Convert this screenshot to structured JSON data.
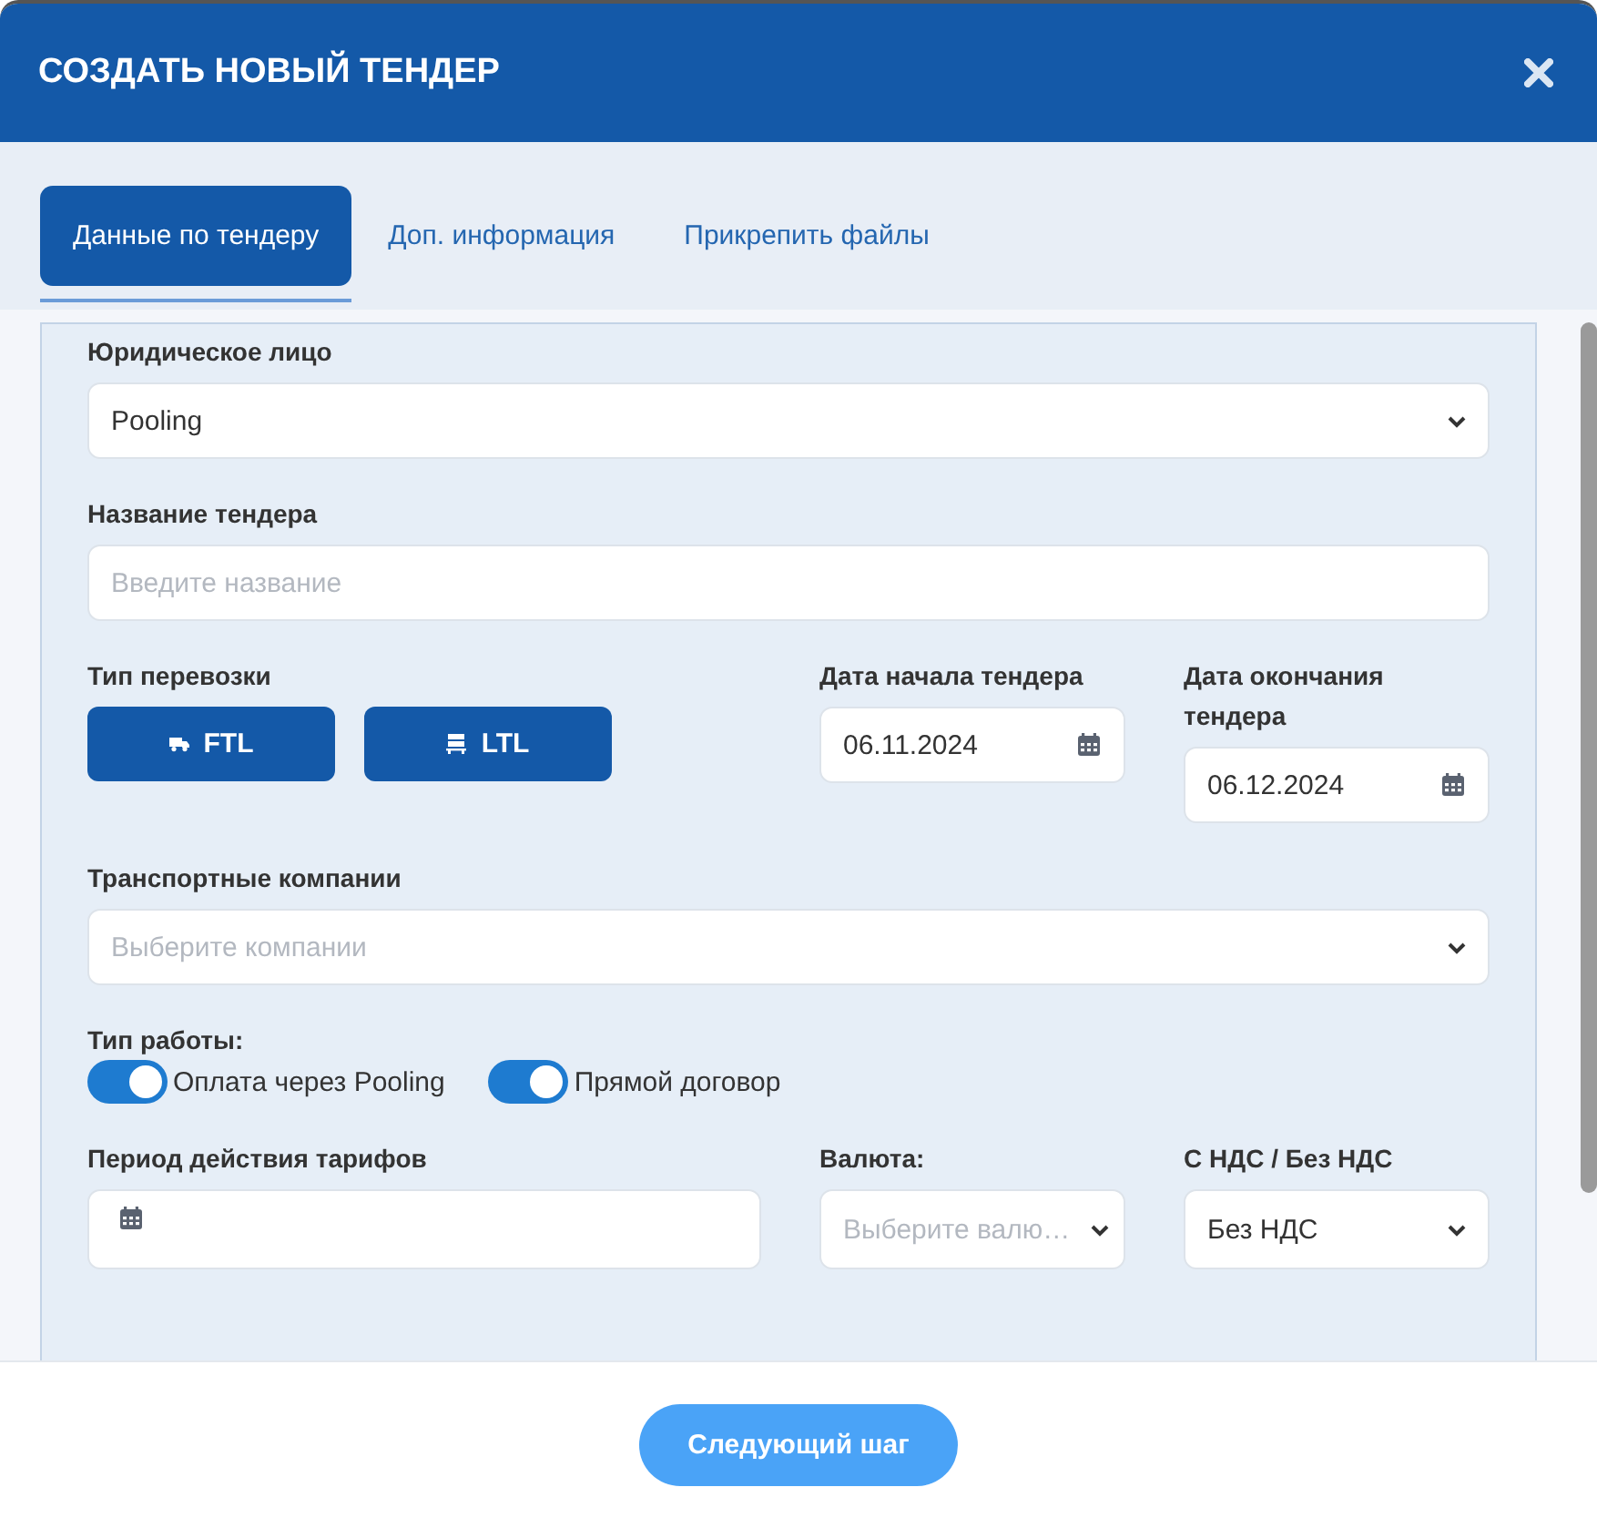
{
  "dialog": {
    "title": "СОЗДАТЬ НОВЫЙ ТЕНДЕР"
  },
  "tabs": [
    {
      "label": "Данные по тендеру",
      "selected": true
    },
    {
      "label": "Доп. информация",
      "selected": false
    },
    {
      "label": "Прикрепить файлы",
      "selected": false
    }
  ],
  "legal_entity": {
    "label": "Юридическое лицо",
    "value": "Pooling"
  },
  "tender_name": {
    "label": "Название тендера",
    "placeholder": "Введите название"
  },
  "transport_type": {
    "label": "Тип перевозки",
    "buttons": [
      {
        "label": "FTL",
        "kind": "truck"
      },
      {
        "label": "LTL",
        "kind": "pallet"
      }
    ]
  },
  "start_date": {
    "label": "Дата начала тендера",
    "value": "06.11.2024"
  },
  "end_date": {
    "label": "Дата окончания тендера",
    "value": "06.12.2024"
  },
  "companies": {
    "label": "Транспортные компании",
    "placeholder": "Выберите компании"
  },
  "work_type": {
    "label": "Тип работы:",
    "toggles": [
      {
        "label": "Оплата через Pooling",
        "on": true
      },
      {
        "label": "Прямой договор",
        "on": true
      }
    ]
  },
  "tariff_period": {
    "label": "Период действия тарифов"
  },
  "currency": {
    "label": "Валюта:",
    "placeholder": "Выберите валю…"
  },
  "vat": {
    "label": "С НДС / Без НДС",
    "value": "Без НДС"
  },
  "next_button": "Следующий шаг"
}
